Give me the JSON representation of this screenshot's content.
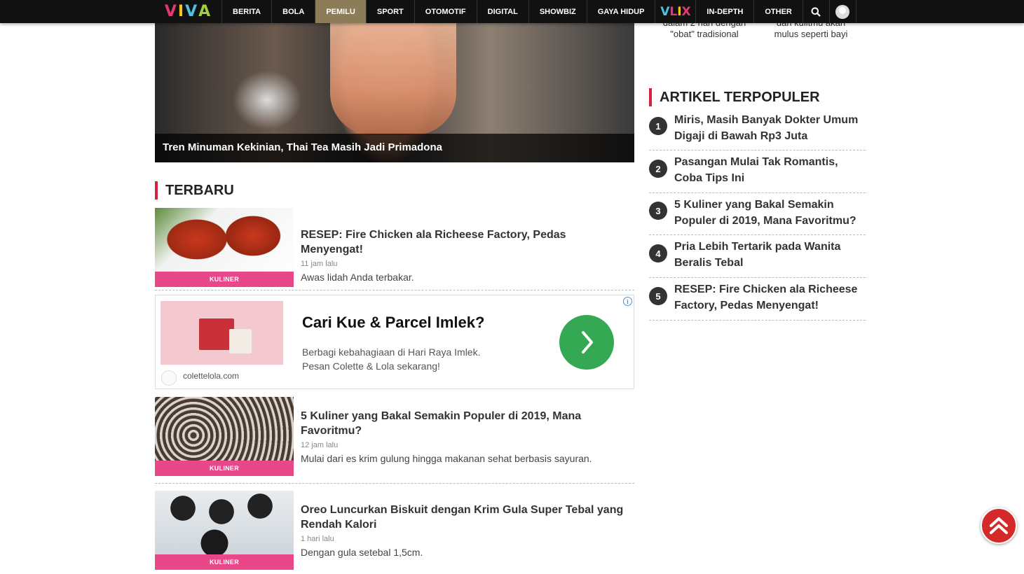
{
  "nav": {
    "logo": [
      "V",
      "I",
      "V",
      "A"
    ],
    "items": [
      "BERITA",
      "BOLA",
      "PEMILU",
      "SPORT",
      "OTOMOTIF",
      "DIGITAL",
      "SHOWBIZ",
      "GAYA HIDUP"
    ],
    "active": "PEMILU",
    "vlix": [
      "V",
      "L",
      "I",
      "X"
    ],
    "items2": [
      "IN-DEPTH",
      "OTHER"
    ]
  },
  "hero": {
    "caption": "Tren Minuman Kekinian, Thai Tea Masih Jadi Primadona"
  },
  "sidebar_top": {
    "left": [
      "dalam 2 hari dengan",
      "\"obat\" tradisional"
    ],
    "right": [
      "dan kulitmu akan",
      "mulus seperti bayi"
    ]
  },
  "terbaru": {
    "title": "TERBARU",
    "articles": [
      {
        "tag": "KULINER",
        "title": "RESEP: Fire Chicken ala Richeese Factory, Pedas Menyengat!",
        "time": "11 jam lalu",
        "desc": "Awas lidah Anda terbakar."
      },
      {
        "tag": "KULINER",
        "title": "5 Kuliner yang Bakal Semakin Populer di 2019, Mana Favoritmu?",
        "time": "12 jam lalu",
        "desc": "Mulai dari es krim gulung hingga makanan sehat berbasis sayuran."
      },
      {
        "tag": "KULINER",
        "title": "Oreo Luncurkan Biskuit dengan Krim Gula Super Tebal yang Rendah Kalori",
        "time": "1 hari lalu",
        "desc": "Dengan gula setebal 1,5cm."
      }
    ]
  },
  "ad": {
    "headline": "Cari Kue & Parcel Imlek?",
    "line1": "Berbagi kebahagiaan di Hari Raya Imlek.",
    "line2": "Pesan Colette & Lola sekarang!",
    "domain": "colettelola.com",
    "info": "i"
  },
  "populer": {
    "title": "ARTIKEL TERPOPULER",
    "items": [
      {
        "num": "1",
        "title": "Miris, Masih Banyak Dokter Umum Digaji di Bawah Rp3 Juta"
      },
      {
        "num": "2",
        "title": "Pasangan Mulai Tak Romantis, Coba Tips Ini"
      },
      {
        "num": "3",
        "title": "5 Kuliner yang Bakal Semakin Populer di 2019, Mana Favoritmu?"
      },
      {
        "num": "4",
        "title": "Pria Lebih Tertarik pada Wanita Beralis Tebal"
      },
      {
        "num": "5",
        "title": "RESEP: Fire Chicken ala Richeese Factory, Pedas Menyengat!"
      }
    ]
  },
  "colors": {
    "accent": "#d7203c",
    "tag": "#e8478a",
    "nav_active": "#8d7c58",
    "cta": "#34a853",
    "scroll_top": "#d42a2a"
  },
  "icons": [
    "search-icon",
    "user-avatar-icon",
    "chevron-right-icon",
    "double-chevron-up-icon",
    "info-icon"
  ]
}
